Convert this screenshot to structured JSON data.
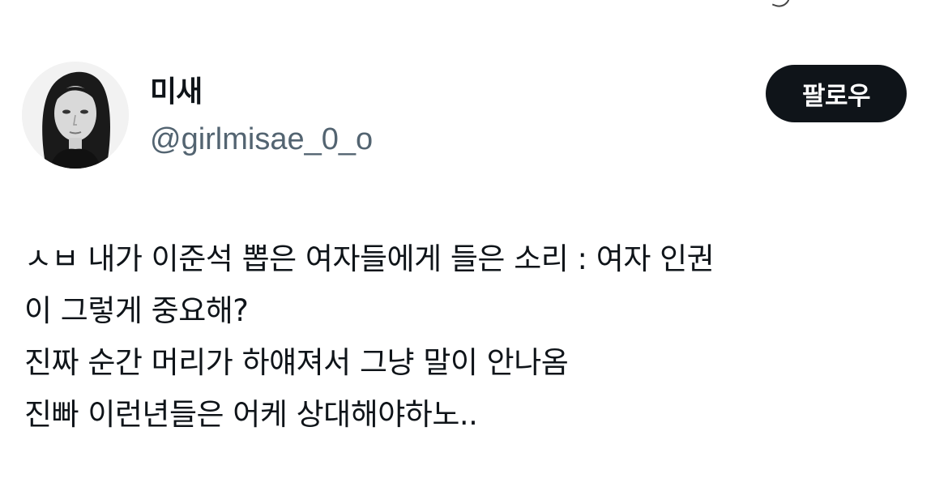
{
  "user": {
    "display_name": "미새",
    "handle": "@girlmisae_0_o"
  },
  "follow_button": {
    "label": "팔로우"
  },
  "tweet": {
    "lines": [
      "ㅅㅂ 내가 이준석 뽑은 여자들에게 들은 소리 : 여자 인권",
      "이 그렇게 중요해?",
      "진짜 순간 머리가 하얘져서 그냥 말이 안나옴",
      "진빠 이런년들은 어케 상대해야하노.."
    ]
  },
  "colors": {
    "text_primary": "#0f1419",
    "text_secondary": "#536471",
    "button_bg": "#0f1419",
    "button_text": "#ffffff",
    "background": "#ffffff"
  }
}
